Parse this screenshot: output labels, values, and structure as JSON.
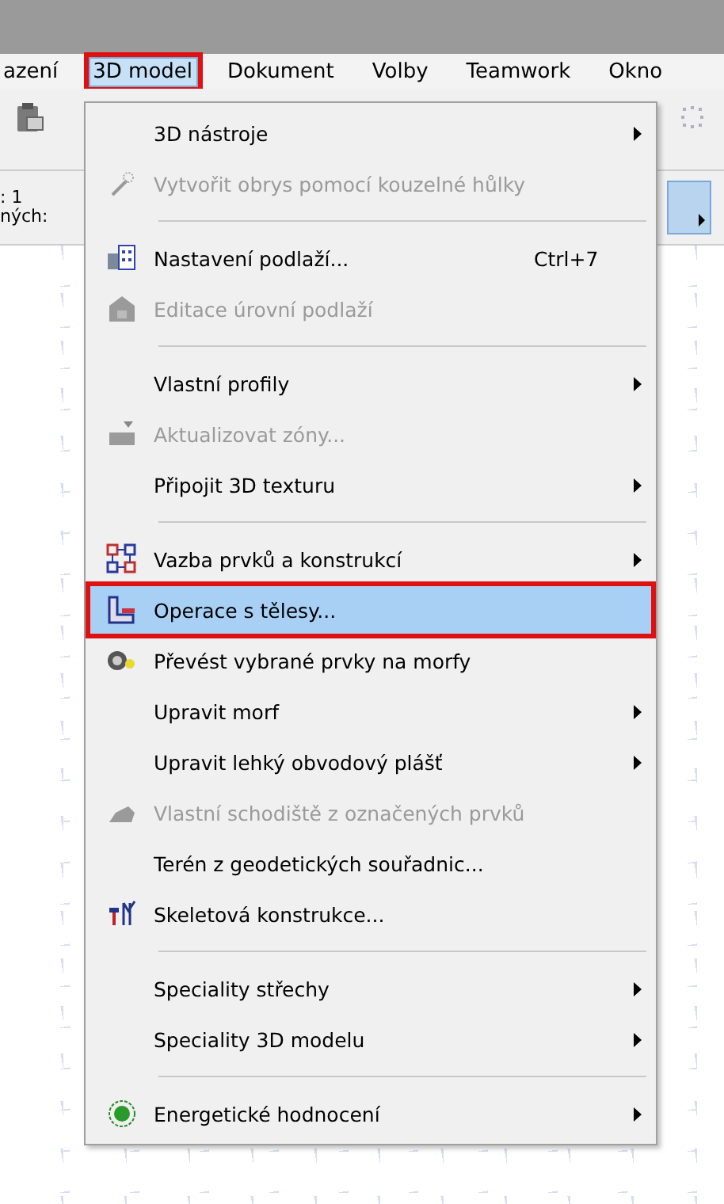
{
  "menu_bar": [
    {
      "label": "azení",
      "selected": false,
      "highlighted": false
    },
    {
      "label": "3D model",
      "selected": true,
      "highlighted": true
    },
    {
      "label": "Dokument",
      "selected": false,
      "highlighted": false
    },
    {
      "label": "Volby",
      "selected": false,
      "highlighted": false
    },
    {
      "label": "Teamwork",
      "selected": false,
      "highlighted": false
    },
    {
      "label": "Okno",
      "selected": false,
      "highlighted": false
    }
  ],
  "side_panel": {
    "lines": [
      ": 1",
      "ných:"
    ]
  },
  "menu": {
    "items": [
      {
        "kind": "item",
        "label": "3D nástroje",
        "disabled": false,
        "submenu": true,
        "selected": false,
        "highlighted": false
      },
      {
        "kind": "item",
        "label": "Vytvořit obrys pomocí kouzelné hůlky",
        "disabled": true,
        "submenu": false,
        "selected": false,
        "highlighted": false
      },
      {
        "kind": "separator"
      },
      {
        "kind": "item",
        "label": "Nastavení podlaží...",
        "shortcut": "Ctrl+7",
        "disabled": false,
        "submenu": false,
        "selected": false,
        "highlighted": false
      },
      {
        "kind": "item",
        "label": "Editace úrovní podlaží",
        "disabled": true,
        "submenu": false,
        "selected": false,
        "highlighted": false
      },
      {
        "kind": "separator"
      },
      {
        "kind": "item",
        "label": "Vlastní profily",
        "disabled": false,
        "submenu": true,
        "selected": false,
        "highlighted": false
      },
      {
        "kind": "item",
        "label": "Aktualizovat zóny...",
        "disabled": true,
        "submenu": false,
        "selected": false,
        "highlighted": false
      },
      {
        "kind": "item",
        "label": "Připojit 3D texturu",
        "disabled": false,
        "submenu": true,
        "selected": false,
        "highlighted": false
      },
      {
        "kind": "separator"
      },
      {
        "kind": "item",
        "label": "Vazba prvků a konstrukcí",
        "disabled": false,
        "submenu": true,
        "selected": false,
        "highlighted": false
      },
      {
        "kind": "item",
        "label": "Operace s tělesy...",
        "disabled": false,
        "submenu": false,
        "selected": true,
        "highlighted": true
      },
      {
        "kind": "item",
        "label": "Převést vybrané prvky na morfy",
        "disabled": false,
        "submenu": false,
        "selected": false,
        "highlighted": false
      },
      {
        "kind": "item",
        "label": "Upravit morf",
        "disabled": false,
        "submenu": true,
        "selected": false,
        "highlighted": false
      },
      {
        "kind": "item",
        "label": "Upravit lehký obvodový plášť",
        "disabled": false,
        "submenu": true,
        "selected": false,
        "highlighted": false
      },
      {
        "kind": "item",
        "label": "Vlastní schodiště z označených prvků",
        "disabled": true,
        "submenu": false,
        "selected": false,
        "highlighted": false
      },
      {
        "kind": "item",
        "label": "Terén z geodetických souřadnic...",
        "disabled": false,
        "submenu": false,
        "selected": false,
        "highlighted": false
      },
      {
        "kind": "item",
        "label": "Skeletová konstrukce...",
        "disabled": false,
        "submenu": false,
        "selected": false,
        "highlighted": false
      },
      {
        "kind": "separator"
      },
      {
        "kind": "item",
        "label": "Speciality střechy",
        "disabled": false,
        "submenu": true,
        "selected": false,
        "highlighted": false
      },
      {
        "kind": "item",
        "label": "Speciality 3D modelu",
        "disabled": false,
        "submenu": true,
        "selected": false,
        "highlighted": false
      },
      {
        "kind": "separator"
      },
      {
        "kind": "item",
        "label": "Energetické hodnocení",
        "disabled": false,
        "submenu": true,
        "selected": false,
        "highlighted": false
      }
    ]
  }
}
